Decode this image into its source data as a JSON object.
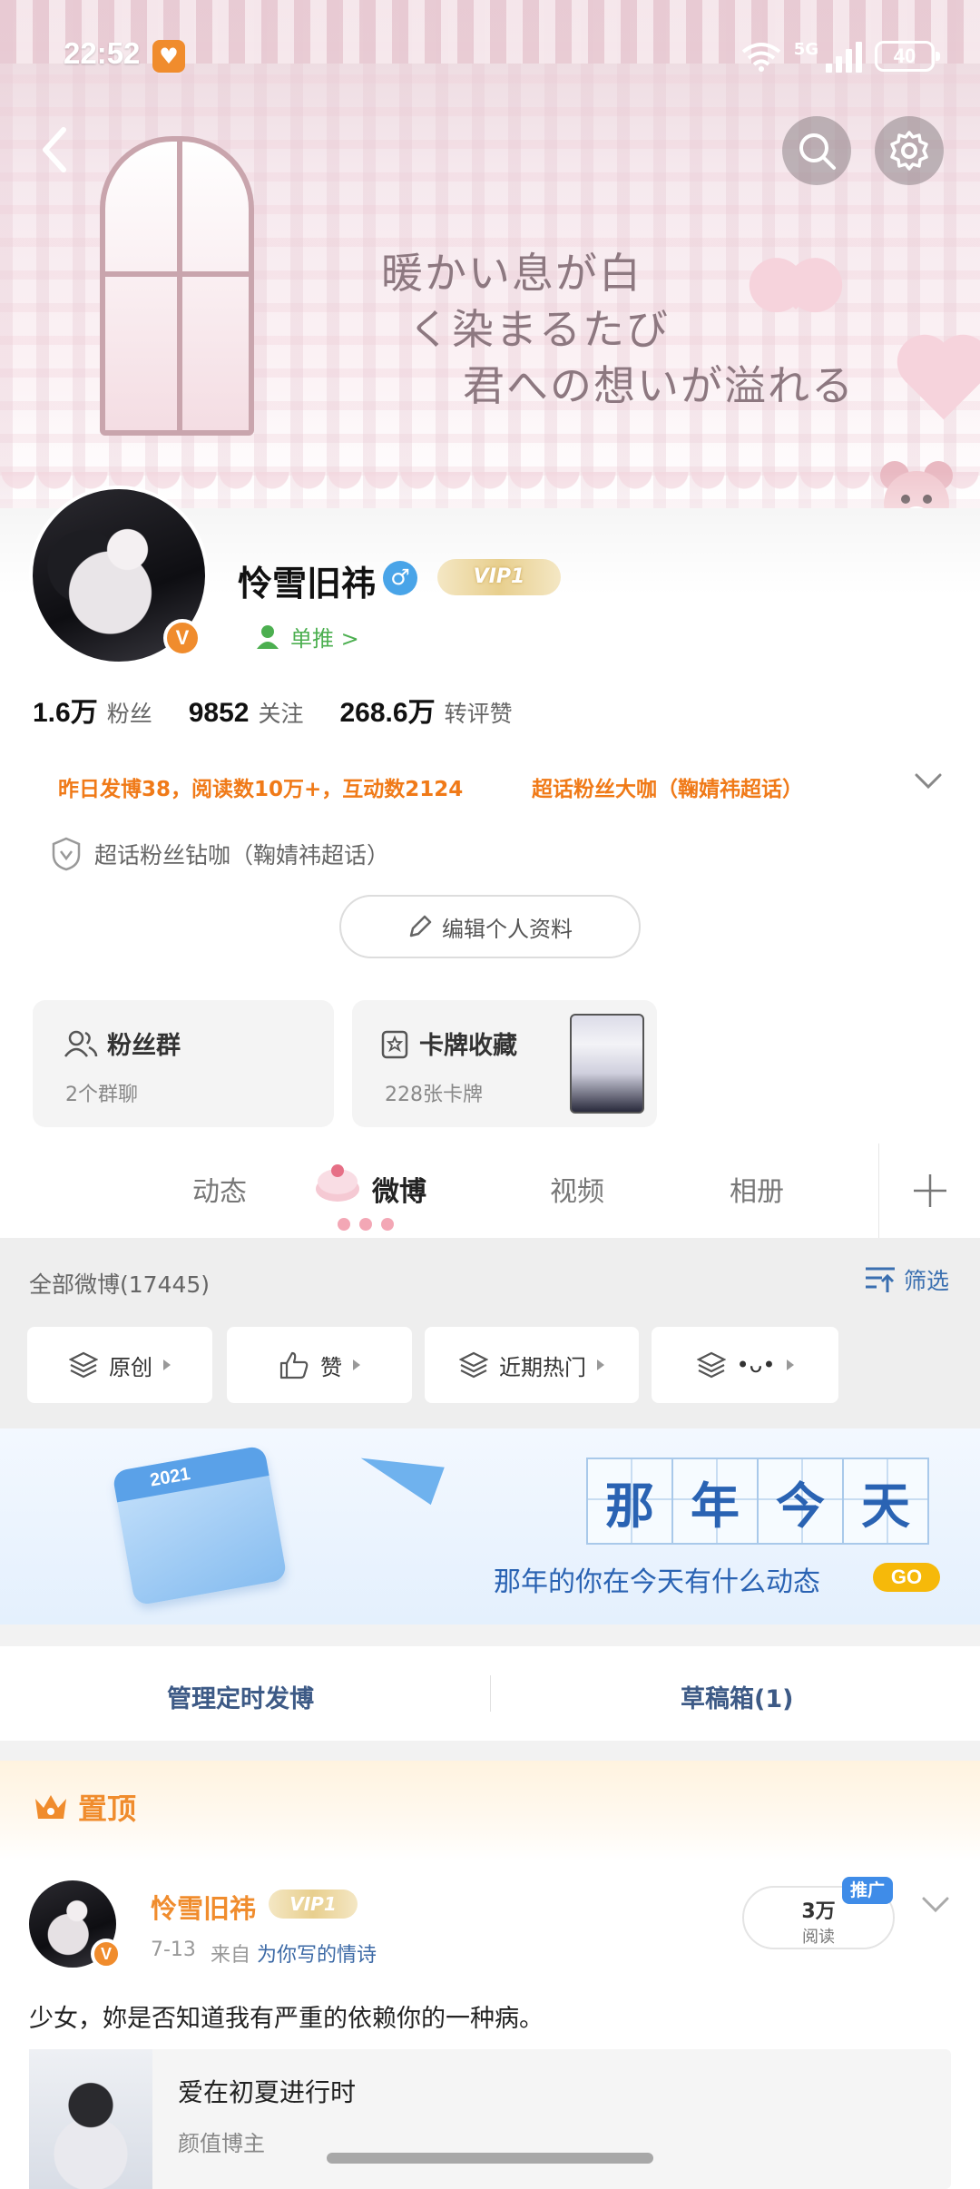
{
  "status_bar": {
    "time": "22:52",
    "network": "5G",
    "battery": "40",
    "app_icon": "heart-icon"
  },
  "banner": {
    "line1": "暖かい息が白",
    "line2": "く染まるたび",
    "line3": "君への想いが溢れる"
  },
  "nav": {
    "back_icon": "back-arrow-icon",
    "search_icon": "search-icon",
    "settings_icon": "gear-icon"
  },
  "profile": {
    "username": "怜雪旧祎",
    "gender_icon": "male-icon",
    "vip_label": "VIP1",
    "verified_badge": "V",
    "single_push": "单推 >",
    "stats": [
      {
        "num": "1.6万",
        "label": "粉丝"
      },
      {
        "num": "9852",
        "label": "关注"
      },
      {
        "num": "268.6万",
        "label": "转评赞"
      }
    ],
    "achievement": "昨日发博38，阅读数10万+，互动数2124",
    "achievement2": "超话粉丝大咖（鞠婧祎超话）",
    "fan_title": "超话粉丝钻咖（鞠婧祎超话）",
    "edit_label": "编辑个人资料"
  },
  "cards": [
    {
      "title": "粉丝群",
      "sub": "2个群聊",
      "icon": "group-icon"
    },
    {
      "title": "卡牌收藏",
      "sub": "228张卡牌",
      "icon": "card-icon"
    }
  ],
  "tabs": [
    "动态",
    "微博",
    "视频",
    "相册"
  ],
  "active_tab": "微博",
  "filter": {
    "all_posts": "全部微博(17445)",
    "filter_label": "筛选",
    "chips": [
      "原创",
      "赞",
      "近期热门",
      "•ᴗ•"
    ]
  },
  "on_this_day": {
    "chars": [
      "那",
      "年",
      "今",
      "天"
    ],
    "subtitle": "那年的你在今天有什么动态",
    "go": "GO",
    "calendar_year": "2021"
  },
  "manage": {
    "scheduled": "管理定时发博",
    "drafts": "草稿箱(1)"
  },
  "post": {
    "pinned": "置顶",
    "author": "怜雪旧祎",
    "vip": "VIP1",
    "date": "7-13",
    "source_prefix": "来自",
    "source": "为你写的情诗",
    "reads_num": "3万",
    "reads_label": "阅读",
    "promo": "推广",
    "text": "少女，妳是否知道我有严重的依赖你的一种病。",
    "link_title": "爱在初夏进行时",
    "link_sub": "颜值博主"
  }
}
